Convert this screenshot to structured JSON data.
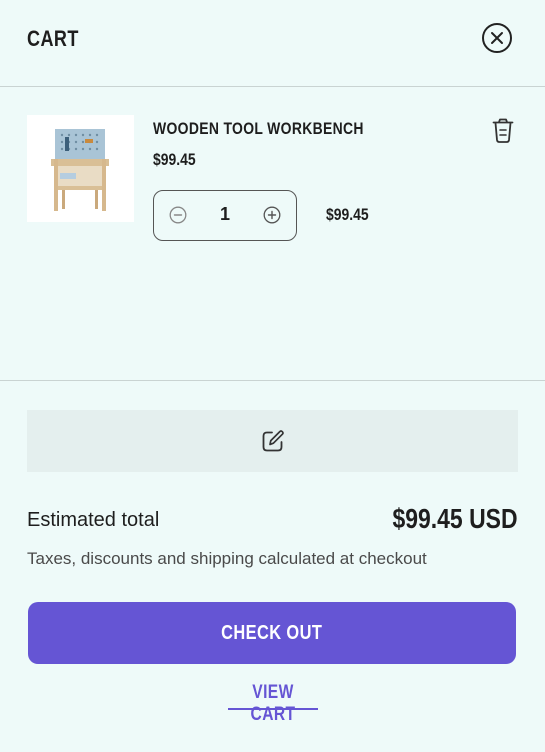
{
  "header": {
    "title": "CART"
  },
  "item": {
    "name": "WOODEN TOOL WORKBENCH",
    "price": "$99.45",
    "quantity": "1",
    "line_total": "$99.45"
  },
  "summary": {
    "estimated_label": "Estimated total",
    "estimated_value": "$99.45 USD",
    "tax_note": "Taxes, discounts and shipping calculated at checkout"
  },
  "actions": {
    "checkout_label": "CHECK OUT",
    "view_cart_label": "VIEW CART"
  },
  "icons": {
    "close": "close-icon",
    "trash": "trash-icon",
    "minus": "minus-circle-icon",
    "plus": "plus-circle-icon",
    "note": "edit-note-icon"
  },
  "colors": {
    "background": "#eefaf9",
    "accent": "#6555d4",
    "note_bg": "#e4efee"
  }
}
